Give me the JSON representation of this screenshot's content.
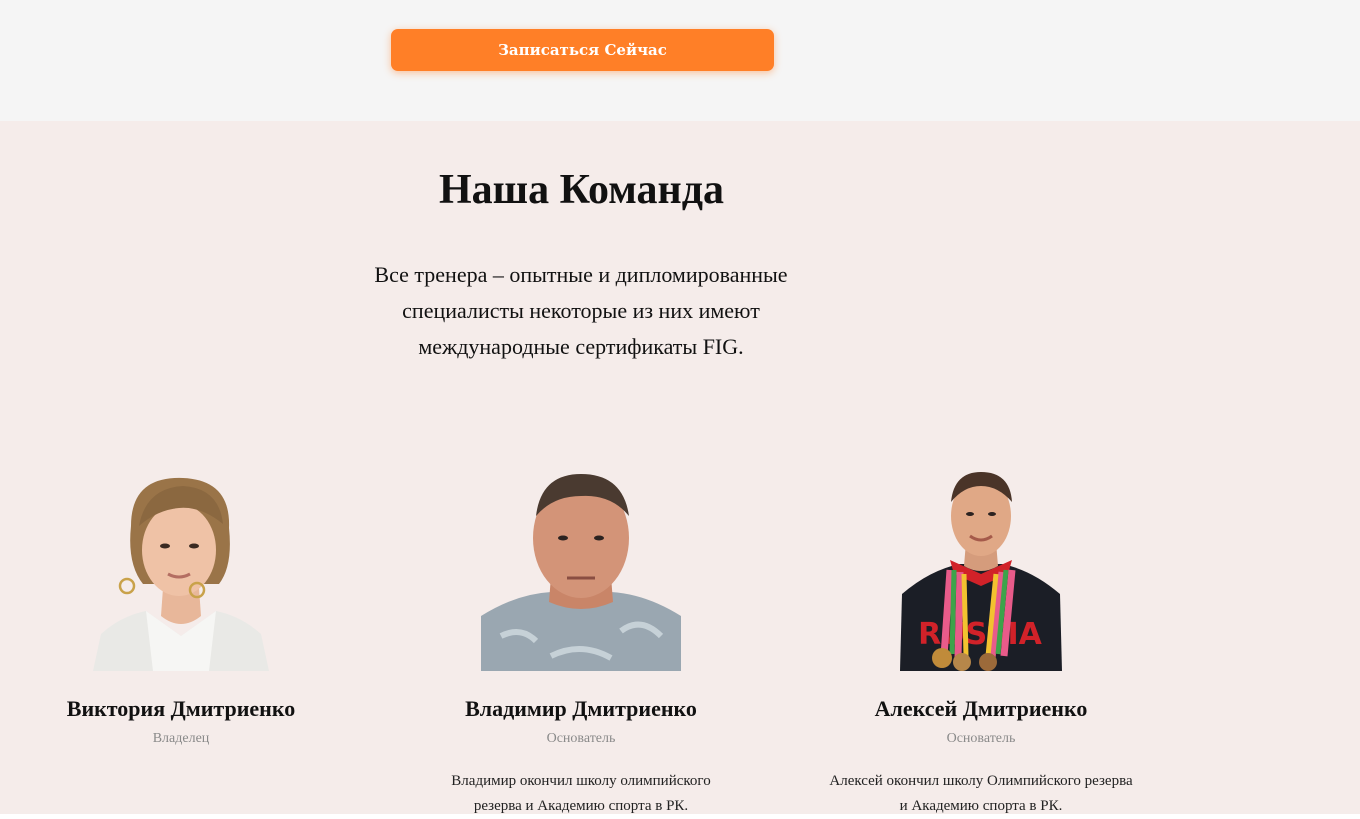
{
  "cta": {
    "label": "Записаться Сейчас",
    "color": "#ff7f27"
  },
  "team": {
    "title": "Наша Команда",
    "description": "Все тренера – опытные и дипломированные специалисты некоторые из них имеют международные сертификаты FIG.",
    "background": "#f5ecea",
    "members": [
      {
        "name": "Виктория Дмитриенко",
        "role": "Владелец",
        "bio": "",
        "photo": "woman-portrait-photo"
      },
      {
        "name": "Владимир Дмитриенко",
        "role": "Основатель",
        "bio": "Владимир окончил школу олимпийского резерва и Академию спорта в РК.",
        "photo": "man-portrait-photo"
      },
      {
        "name": "Алексей Дмитриенко",
        "role": "Основатель",
        "bio": "Алексей окончил школу Олимпийского резерва и Академию спорта в РК.",
        "photo": "athlete-with-medals-photo"
      }
    ]
  }
}
